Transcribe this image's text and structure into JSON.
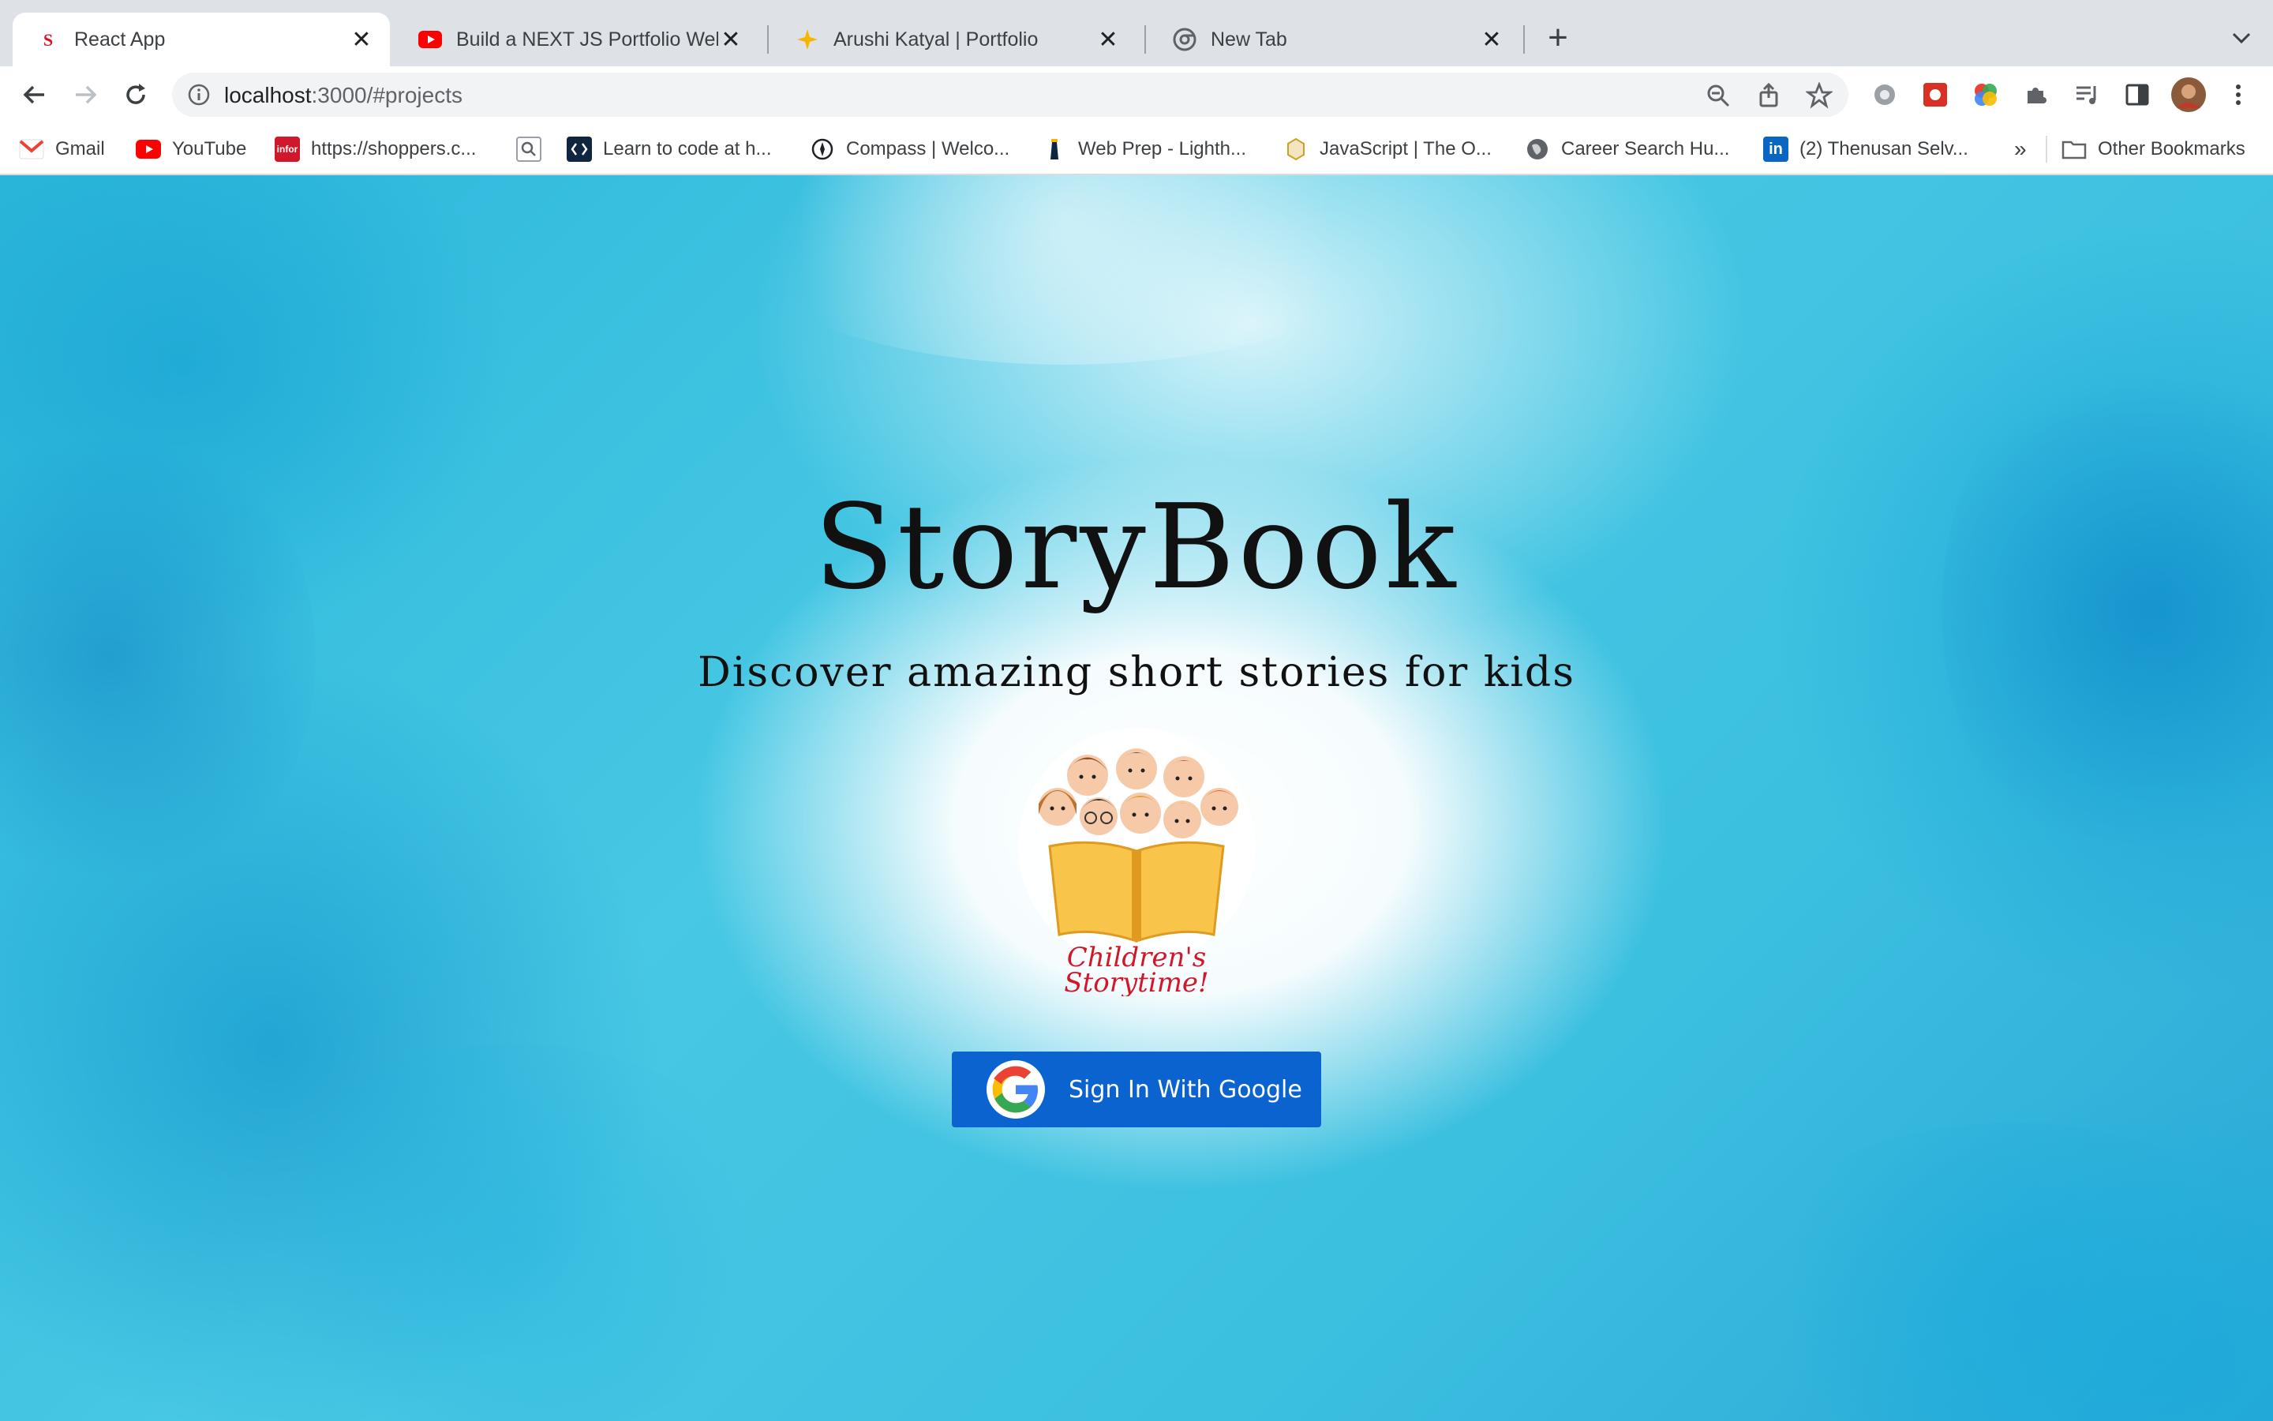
{
  "browser": {
    "tabs": [
      {
        "title": "React App",
        "favicon": "react-app-favicon",
        "active": true
      },
      {
        "title": "Build a NEXT JS Portfolio Webs",
        "favicon": "youtube-favicon",
        "active": false
      },
      {
        "title": "Arushi Katyal | Portfolio",
        "favicon": "sparkle-favicon",
        "active": false
      },
      {
        "title": "New Tab",
        "favicon": "chrome-favicon",
        "active": false
      }
    ],
    "new_tab_label": "+",
    "tab_close_label": "✕",
    "url_host": "localhost",
    "url_path": ":3000/#projects",
    "bookmarks": [
      {
        "label": "Gmail",
        "icon": "gmail-icon"
      },
      {
        "label": "YouTube",
        "icon": "youtube-icon"
      },
      {
        "label": "https://shoppers.c...",
        "icon": "infor-icon",
        "icon_text": "infor"
      },
      {
        "label": "",
        "icon": "search-bookmark-icon"
      },
      {
        "label": "Learn to code at h...",
        "icon": "lighthouse-code-icon"
      },
      {
        "label": "Compass | Welco...",
        "icon": "compass-icon"
      },
      {
        "label": "Web Prep - Lighth...",
        "icon": "lighthouse-icon"
      },
      {
        "label": "JavaScript | The O...",
        "icon": "javascript-icon"
      },
      {
        "label": "Career Search Hu...",
        "icon": "globe-icon"
      },
      {
        "label": "(2) Thenusan Selv...",
        "icon": "linkedin-icon",
        "icon_text": "in"
      }
    ],
    "bookmarks_overflow": "»",
    "other_bookmarks": "Other Bookmarks"
  },
  "page": {
    "title": "StoryBook",
    "subtitle": "Discover amazing short stories for kids",
    "logo_line1": "Children's",
    "logo_line2": "Storytime!",
    "signin_label": "Sign In With Google"
  },
  "colors": {
    "tabstrip": "#dee1e6",
    "signin_button": "#0b63cf",
    "logo_text": "#d0182a",
    "book": "#f8c44a"
  }
}
